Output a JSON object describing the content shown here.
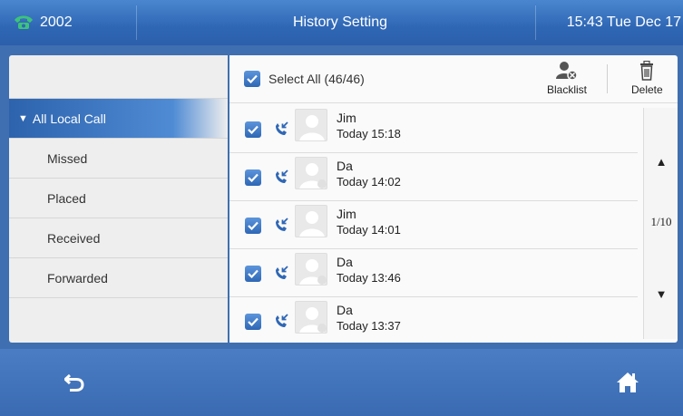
{
  "status_bar": {
    "account": "2002",
    "title": "History Setting",
    "clock": "15:43 Tue Dec 17"
  },
  "nav": {
    "items": [
      {
        "label": "All Local Call",
        "active": true
      },
      {
        "label": "Missed",
        "active": false
      },
      {
        "label": "Placed",
        "active": false
      },
      {
        "label": "Received",
        "active": false
      },
      {
        "label": "Forwarded",
        "active": false
      }
    ]
  },
  "toolbar": {
    "select_all_label": "Select All (46/46)",
    "blacklist_label": "Blacklist",
    "delete_label": "Delete"
  },
  "calls": [
    {
      "name": "Jim",
      "time": "Today 15:18",
      "checked": true,
      "direction": "received-call-icon"
    },
    {
      "name": "Da",
      "time": "Today 14:02",
      "checked": true,
      "direction": "received-call-icon"
    },
    {
      "name": "Jim",
      "time": "Today 14:01",
      "checked": true,
      "direction": "received-call-icon"
    },
    {
      "name": "Da",
      "time": "Today 13:46",
      "checked": true,
      "direction": "received-call-icon"
    },
    {
      "name": "Da",
      "time": "Today 13:37",
      "checked": true,
      "direction": "received-call-icon"
    }
  ],
  "pager": {
    "page": "1/10"
  },
  "colors": {
    "accent": "#2f67b5",
    "call_icon": "#2f67b5",
    "phone_icon": "#3cc47a"
  },
  "softkeys": {
    "left": "back-icon",
    "right": "home-icon"
  }
}
